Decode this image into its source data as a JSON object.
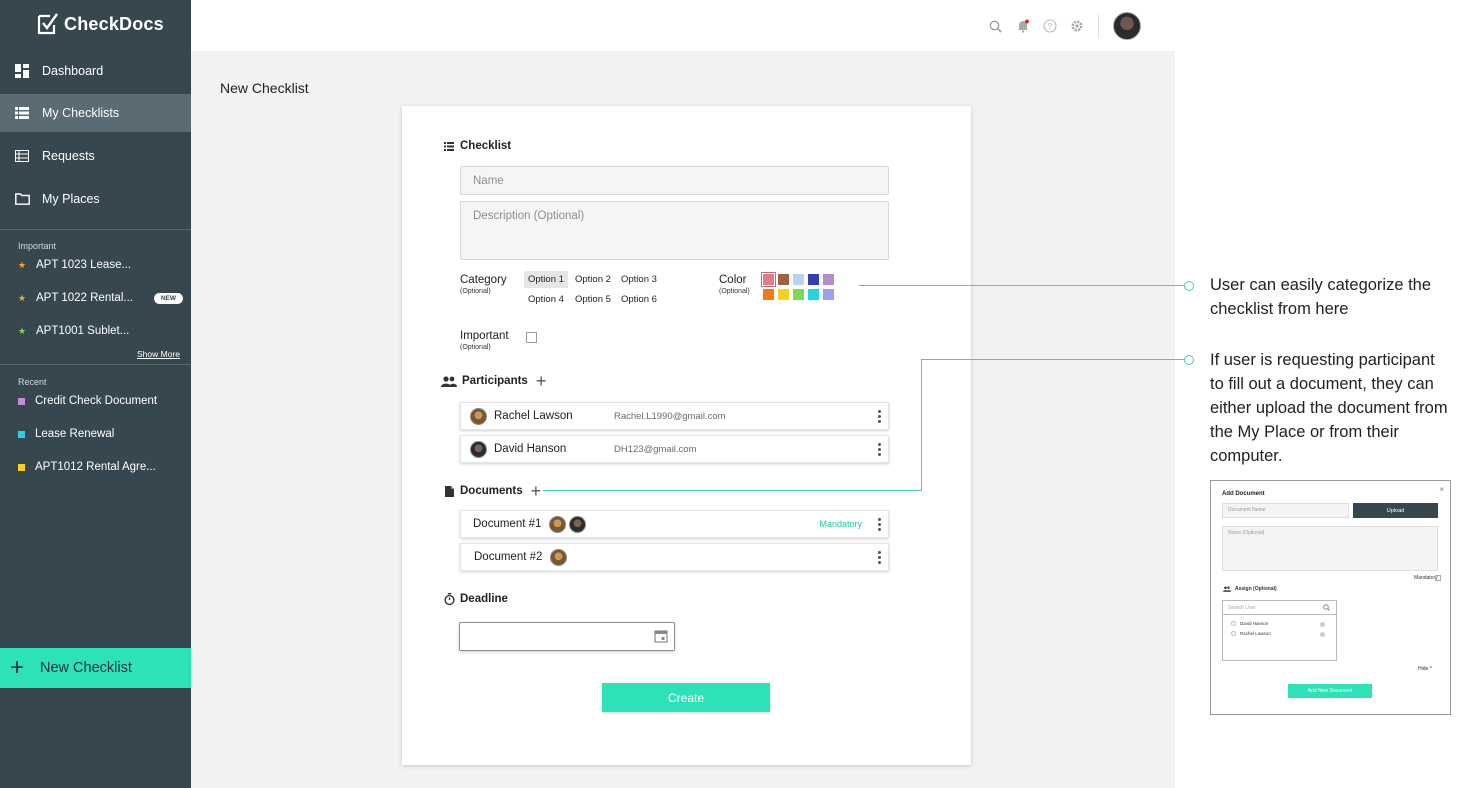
{
  "app": {
    "name": "CheckDocs"
  },
  "sidebar": {
    "nav": [
      {
        "label": "Dashboard",
        "icon": "dashboard-icon"
      },
      {
        "label": "My Checklists",
        "icon": "list-icon",
        "active": true
      },
      {
        "label": "Requests",
        "icon": "requests-icon"
      },
      {
        "label": "My Places",
        "icon": "folder-icon"
      }
    ],
    "important": {
      "title": "Important",
      "items": [
        {
          "label": "APT 1023 Lease...",
          "star_color": "#f5a623"
        },
        {
          "label": "APT 1022 Rental...",
          "star_color": "#f5a623",
          "badge": "NEW"
        },
        {
          "label": "APT1001 Sublet...",
          "star_color": "#7ed957"
        }
      ],
      "show_more": "Show More"
    },
    "recent": {
      "title": "Recent",
      "items": [
        {
          "label": "Credit Check Document",
          "color": "#c58bd6"
        },
        {
          "label": "Lease Renewal",
          "color": "#26d3e0"
        },
        {
          "label": "APT1012  Rental Agre...",
          "color": "#f5d21f"
        }
      ]
    },
    "new_checklist": "New Checklist"
  },
  "page": {
    "title": "New Checklist"
  },
  "form": {
    "checklist_heading": "Checklist",
    "name_placeholder": "Name",
    "description_placeholder": "Description (Optional)",
    "category_label": "Category",
    "category_sub": "(Optional)",
    "category_options": [
      "Option 1",
      "Option 2",
      "Option 3",
      "Option 4",
      "Option 5",
      "Option 6"
    ],
    "color_label": "Color",
    "color_sub": "(Optional)",
    "colors": [
      "#e07b8a",
      "#a0633f",
      "#b7d3f0",
      "#3141b3",
      "#b68bcb",
      "#f07d14",
      "#f5d21f",
      "#7ed957",
      "#26d3e0",
      "#9aa2ef"
    ],
    "important_label": "Important",
    "important_sub": "(Optional)",
    "participants_heading": "Participants",
    "participants": [
      {
        "name": "Rachel Lawson",
        "email": "Rachel.L1990@gmail.com"
      },
      {
        "name": "David Hanson",
        "email": "DH123@gmail.com"
      }
    ],
    "documents_heading": "Documents",
    "documents": [
      {
        "name": "Document #1",
        "status": "Mandatory"
      },
      {
        "name": "Document #2",
        "status": ""
      }
    ],
    "deadline_heading": "Deadline",
    "create_label": "Create"
  },
  "annotations": {
    "note1": "User can easily categorize the checklist from here",
    "note2": "If user is requesting participant to fill out a document, they can either upload the document from the My Place or from their computer."
  },
  "add_document_modal": {
    "title": "Add Document",
    "close": "×",
    "name_placeholder": "Document Name",
    "upload": "Upload",
    "notes_placeholder": "Notes (Optional)",
    "mandatory": "Mandatory",
    "assign": "Assign (Optional)",
    "search_placeholder": "Search User",
    "users": [
      "David Hanson",
      "Rachel Lawson"
    ],
    "hide": "Hide ^",
    "add_button": "Add New Document"
  }
}
